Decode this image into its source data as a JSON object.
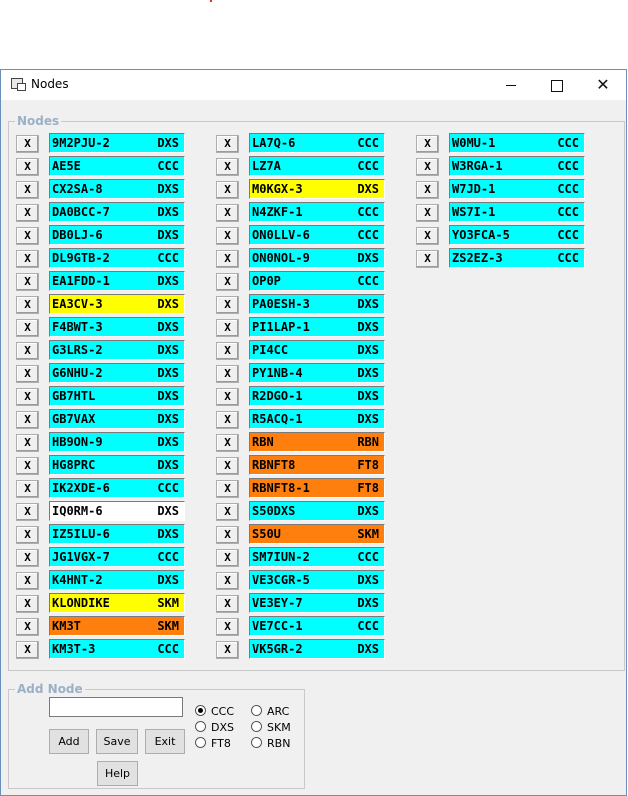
{
  "window": {
    "title": "Nodes",
    "minimize": "—",
    "close": "✕"
  },
  "nodes_group": {
    "label": "Nodes"
  },
  "remove_label": "X",
  "colors": {
    "DXS": "#00ffff",
    "CCC": "#00ffff",
    "SKM_yellow": "#ffff00",
    "SKM_orange": "#ff7f0e",
    "white": "#ffffff"
  },
  "columns": [
    [
      {
        "call": "9M2PJU-2",
        "type": "DXS",
        "color": "#00ffff"
      },
      {
        "call": "AE5E",
        "type": "CCC",
        "color": "#00ffff"
      },
      {
        "call": "CX2SA-8",
        "type": "DXS",
        "color": "#00ffff"
      },
      {
        "call": "DA0BCC-7",
        "type": "DXS",
        "color": "#00ffff"
      },
      {
        "call": "DB0LJ-6",
        "type": "DXS",
        "color": "#00ffff"
      },
      {
        "call": "DL9GTB-2",
        "type": "CCC",
        "color": "#00ffff"
      },
      {
        "call": "EA1FDD-1",
        "type": "DXS",
        "color": "#00ffff"
      },
      {
        "call": "EA3CV-3",
        "type": "DXS",
        "color": "#ffff00"
      },
      {
        "call": "F4BWT-3",
        "type": "DXS",
        "color": "#00ffff"
      },
      {
        "call": "G3LRS-2",
        "type": "DXS",
        "color": "#00ffff"
      },
      {
        "call": "G6NHU-2",
        "type": "DXS",
        "color": "#00ffff"
      },
      {
        "call": "GB7HTL",
        "type": "DXS",
        "color": "#00ffff"
      },
      {
        "call": "GB7VAX",
        "type": "DXS",
        "color": "#00ffff"
      },
      {
        "call": "HB9ON-9",
        "type": "DXS",
        "color": "#00ffff"
      },
      {
        "call": "HG8PRC",
        "type": "DXS",
        "color": "#00ffff"
      },
      {
        "call": "IK2XDE-6",
        "type": "CCC",
        "color": "#00ffff"
      },
      {
        "call": "IQ0RM-6",
        "type": "DXS",
        "color": "#ffffff"
      },
      {
        "call": "IZ5ILU-6",
        "type": "DXS",
        "color": "#00ffff"
      },
      {
        "call": "JG1VGX-7",
        "type": "CCC",
        "color": "#00ffff"
      },
      {
        "call": "K4HNT-2",
        "type": "DXS",
        "color": "#00ffff"
      },
      {
        "call": "KLONDIKE",
        "type": "SKM",
        "color": "#ffff00"
      },
      {
        "call": "KM3T",
        "type": "SKM",
        "color": "#ff7f0e"
      },
      {
        "call": "KM3T-3",
        "type": "CCC",
        "color": "#00ffff"
      }
    ],
    [
      {
        "call": "LA7Q-6",
        "type": "CCC",
        "color": "#00ffff"
      },
      {
        "call": "LZ7A",
        "type": "CCC",
        "color": "#00ffff"
      },
      {
        "call": "M0KGX-3",
        "type": "DXS",
        "color": "#ffff00"
      },
      {
        "call": "N4ZKF-1",
        "type": "CCC",
        "color": "#00ffff"
      },
      {
        "call": "ON0LLV-6",
        "type": "CCC",
        "color": "#00ffff"
      },
      {
        "call": "ON0NOL-9",
        "type": "DXS",
        "color": "#00ffff"
      },
      {
        "call": "OP0P",
        "type": "CCC",
        "color": "#00ffff"
      },
      {
        "call": "PA0ESH-3",
        "type": "DXS",
        "color": "#00ffff"
      },
      {
        "call": "PI1LAP-1",
        "type": "DXS",
        "color": "#00ffff"
      },
      {
        "call": "PI4CC",
        "type": "DXS",
        "color": "#00ffff"
      },
      {
        "call": "PY1NB-4",
        "type": "DXS",
        "color": "#00ffff"
      },
      {
        "call": "R2DGO-1",
        "type": "DXS",
        "color": "#00ffff"
      },
      {
        "call": "R5ACQ-1",
        "type": "DXS",
        "color": "#00ffff"
      },
      {
        "call": "RBN",
        "type": "RBN",
        "color": "#ff7f0e"
      },
      {
        "call": "RBNFT8",
        "type": "FT8",
        "color": "#ff7f0e"
      },
      {
        "call": "RBNFT8-1",
        "type": "FT8",
        "color": "#ff7f0e"
      },
      {
        "call": "S50DXS",
        "type": "DXS",
        "color": "#00ffff"
      },
      {
        "call": "S50U",
        "type": "SKM",
        "color": "#ff7f0e"
      },
      {
        "call": "SM7IUN-2",
        "type": "CCC",
        "color": "#00ffff"
      },
      {
        "call": "VE3CGR-5",
        "type": "DXS",
        "color": "#00ffff"
      },
      {
        "call": "VE3EY-7",
        "type": "DXS",
        "color": "#00ffff"
      },
      {
        "call": "VE7CC-1",
        "type": "CCC",
        "color": "#00ffff"
      },
      {
        "call": "VK5GR-2",
        "type": "DXS",
        "color": "#00ffff"
      }
    ],
    [
      {
        "call": "W0MU-1",
        "type": "CCC",
        "color": "#00ffff"
      },
      {
        "call": "W3RGA-1",
        "type": "CCC",
        "color": "#00ffff"
      },
      {
        "call": "W7JD-1",
        "type": "CCC",
        "color": "#00ffff"
      },
      {
        "call": "WS7I-1",
        "type": "CCC",
        "color": "#00ffff"
      },
      {
        "call": "YO3FCA-5",
        "type": "CCC",
        "color": "#00ffff"
      },
      {
        "call": "ZS2EZ-3",
        "type": "CCC",
        "color": "#00ffff"
      }
    ]
  ],
  "add_node": {
    "label": "Add Node",
    "input_value": "",
    "buttons": {
      "add": "Add",
      "save": "Save",
      "exit": "Exit",
      "help": "Help"
    },
    "radios": [
      {
        "label": "CCC",
        "checked": true
      },
      {
        "label": "ARC",
        "checked": false
      },
      {
        "label": "DXS",
        "checked": false
      },
      {
        "label": "SKM",
        "checked": false
      },
      {
        "label": "FT8",
        "checked": false
      },
      {
        "label": "RBN",
        "checked": false
      }
    ]
  }
}
